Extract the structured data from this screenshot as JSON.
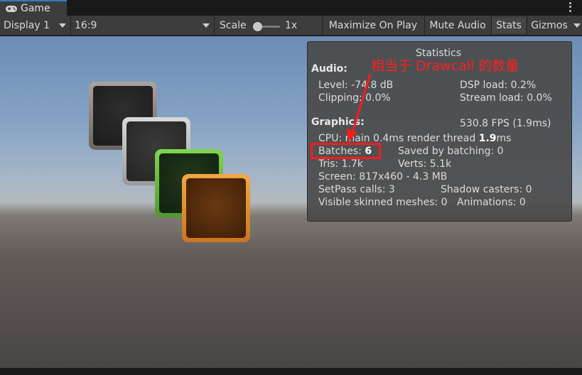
{
  "tab": {
    "label": "Game",
    "icon": "gamepad-icon"
  },
  "window": {
    "menu_icon": "kebab-menu-icon"
  },
  "toolbar": {
    "display": "Display 1",
    "aspect": "16:9",
    "scale_label": "Scale",
    "scale_value": "1x",
    "maximize": "Maximize On Play",
    "mute": "Mute Audio",
    "stats": "Stats",
    "gizmos": "Gizmos"
  },
  "stats": {
    "title": "Statistics",
    "audio_header": "Audio:",
    "level": "Level: -74.8 dB",
    "clipping": "Clipping: 0.0%",
    "dsp_load": "DSP load: 0.2%",
    "stream_load": "Stream load: 0.0%",
    "graphics_header": "Graphics:",
    "fps": "530.8 FPS (1.9ms)",
    "cpu_prefix": "CPU: main 0.4ms  render thread ",
    "cpu_render": "1.9",
    "cpu_suffix": "ms",
    "batches_label": "Batches: ",
    "batches_value": "6",
    "saved_by_batching": "Saved by batching: 0",
    "tris": "Tris: 1.7k",
    "verts": "Verts: 5.1k",
    "screen": "Screen: 817x460 - 4.3 MB",
    "setpass": "SetPass calls: 3",
    "shadow_casters": "Shadow casters: 0",
    "skinned_meshes": "Visible skinned meshes: 0",
    "animations": "Animations: 0"
  },
  "annotation": {
    "text": "相当于 Drawcall 的数量",
    "color": "#ff2020"
  },
  "colors": {
    "accent_tab": "#3a79bb",
    "panel_bg": "#4a4a4a",
    "toolbar_bg": "#3c3c3c"
  },
  "cards": [
    {
      "name": "dark-frame",
      "border": "#8a837f"
    },
    {
      "name": "grey-frame",
      "border": "#c4c4c4"
    },
    {
      "name": "green-frame",
      "border": "#6dbf45"
    },
    {
      "name": "orange-frame",
      "border": "#e8952f"
    }
  ]
}
